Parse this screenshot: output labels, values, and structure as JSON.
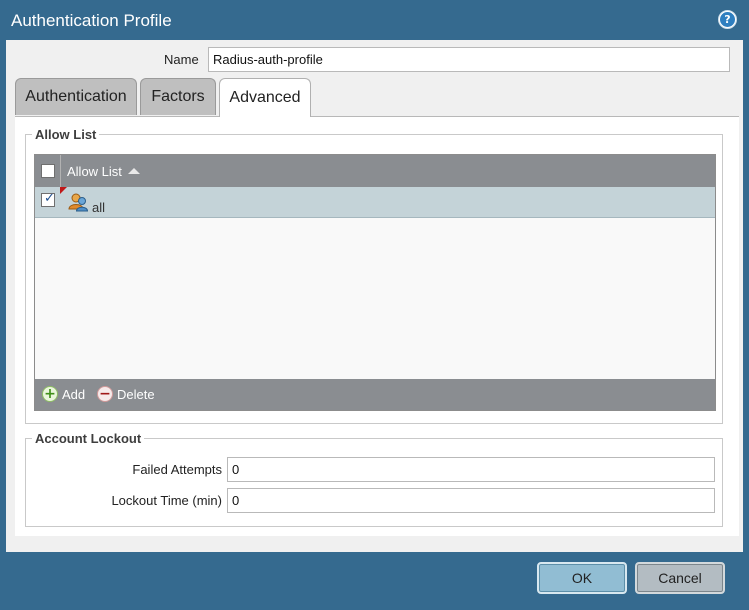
{
  "dialog": {
    "title": "Authentication Profile"
  },
  "name_field": {
    "label": "Name",
    "value": "Radius-auth-profile"
  },
  "tabs": [
    {
      "label": "Authentication",
      "active": false
    },
    {
      "label": "Factors",
      "active": false
    },
    {
      "label": "Advanced",
      "active": true
    }
  ],
  "allow_list": {
    "group_title": "Allow List",
    "column_header": "Allow List",
    "sort": "ascending",
    "rows": [
      {
        "label": "all",
        "checked": true,
        "icon": "user-group-icon"
      }
    ],
    "actions": {
      "add_label": "Add",
      "delete_label": "Delete"
    }
  },
  "account_lockout": {
    "group_title": "Account Lockout",
    "failed_attempts_label": "Failed Attempts",
    "failed_attempts_value": "0",
    "lockout_time_label": "Lockout Time (min)",
    "lockout_time_value": "0"
  },
  "buttons": {
    "ok_label": "OK",
    "cancel_label": "Cancel"
  },
  "colors": {
    "titlebar": "#356a8f",
    "selected_row": "#c4d3d8",
    "grid_header": "#8a8d91"
  }
}
